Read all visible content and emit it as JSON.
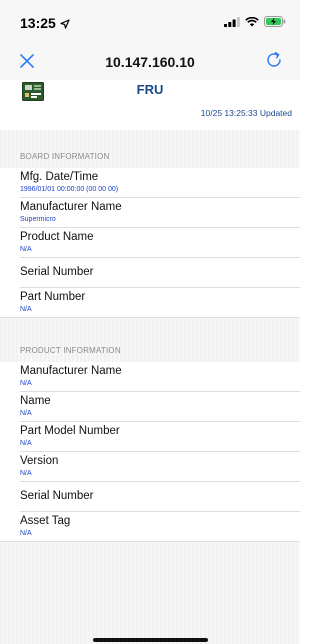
{
  "status_bar": {
    "time": "13:25",
    "icons": [
      "location-arrow-icon",
      "signal-icon",
      "wifi-icon",
      "battery-charging-icon"
    ]
  },
  "nav": {
    "title": "10.147.160.10",
    "close_icon": "close-icon",
    "refresh_icon": "refresh-icon"
  },
  "header": {
    "icon": "board-icon",
    "title": "FRU",
    "updated": "10/25 13:25:33 Updated"
  },
  "board_section": {
    "header": "BOARD INFORMATION",
    "rows": [
      {
        "label": "Mfg. Date/Time",
        "value": "1996/01/01 00:00:00 (00 00 00)"
      },
      {
        "label": "Manufacturer Name",
        "value": "Supermicro"
      },
      {
        "label": "Product Name",
        "value": "N/A"
      },
      {
        "label": "Serial Number",
        "value": ""
      },
      {
        "label": "Part Number",
        "value": "N/A"
      }
    ]
  },
  "product_section": {
    "header": "PRODUCT INFORMATION",
    "rows": [
      {
        "label": "Manufacturer Name",
        "value": "N/A"
      },
      {
        "label": "Name",
        "value": "N/A"
      },
      {
        "label": "Part Model Number",
        "value": "N/A"
      },
      {
        "label": "Version",
        "value": "N/A"
      },
      {
        "label": "Serial Number",
        "value": ""
      },
      {
        "label": "Asset Tag",
        "value": "N/A"
      }
    ]
  },
  "colors": {
    "accent": "#2f7df6",
    "value_text": "#1a3fd0",
    "header_text": "#1a4a8c",
    "battery": "#35c759"
  }
}
